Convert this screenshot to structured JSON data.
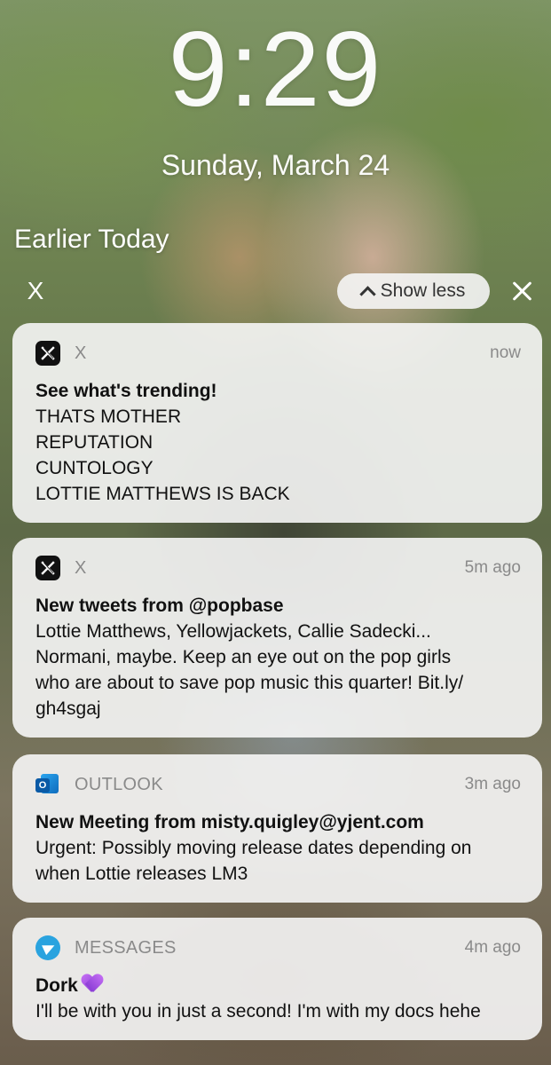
{
  "lockscreen": {
    "time": "9:29",
    "date": "Sunday, March 24",
    "section_title": "Earlier Today",
    "dismiss_left_label": "X",
    "show_less_label": "Show less"
  },
  "notifications": [
    {
      "app": "X",
      "icon": "x-logo-icon",
      "time": "now",
      "title": "See what's trending!",
      "lines": [
        "THATS MOTHER",
        "REPUTATION",
        "CUNTOLOGY",
        "LOTTIE MATTHEWS IS BACK"
      ]
    },
    {
      "app": "X",
      "icon": "x-logo-icon",
      "time": "5m ago",
      "title": "New tweets from @popbase",
      "lines": [
        "Lottie Matthews, Yellowjackets, Callie Sadecki...",
        "Normani, maybe. Keep an eye out on the pop girls",
        "who are about to save pop music this quarter! Bit.ly/",
        "gh4sgaj"
      ]
    },
    {
      "app": "OUTLOOK",
      "icon": "outlook-icon",
      "time": "3m ago",
      "title": "New Meeting from misty.quigley@yjent.com",
      "lines": [
        "Urgent: Possibly moving release dates depending on",
        "when Lottie releases LM3"
      ]
    },
    {
      "app": "MESSAGES",
      "icon": "telegram-icon",
      "time": "4m ago",
      "title": "Dork",
      "title_emoji": "purple-heart-icon",
      "lines": [
        "I'll be with you in just a second! I'm with my docs hehe"
      ]
    }
  ],
  "colors": {
    "card_background": "#f6f6f6",
    "secondary_text": "#8a8a8a",
    "telegram_blue": "#2aa3df",
    "outlook_blue": "#0f6cbd",
    "heart_purple": "#a050e0"
  }
}
